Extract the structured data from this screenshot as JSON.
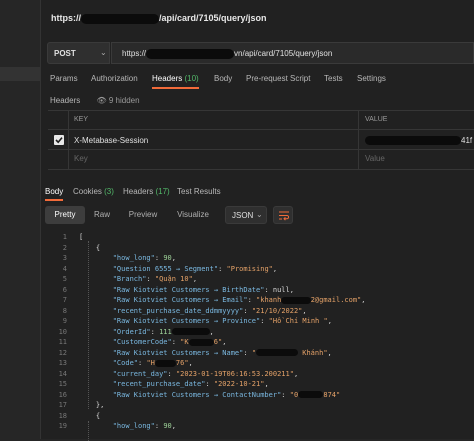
{
  "request": {
    "title_prefix": "https://",
    "title_suffix": "/api/card/7105/query/json",
    "method": "POST",
    "url_prefix": "https://",
    "url_suffix": "vn/api/card/7105/query/json"
  },
  "request_tabs": [
    {
      "label": "Params"
    },
    {
      "label": "Authorization"
    },
    {
      "label": "Headers",
      "count": "(10)"
    },
    {
      "label": "Body"
    },
    {
      "label": "Pre-request Script"
    },
    {
      "label": "Tests"
    },
    {
      "label": "Settings"
    }
  ],
  "headers_section": {
    "label": "Headers",
    "hidden": "9 hidden",
    "hidden_icon": "eye-off-icon"
  },
  "headers_table": {
    "col_key": "KEY",
    "col_value": "VALUE",
    "row_key": "X-Metabase-Session",
    "row_value_tail": "41f",
    "key_placeholder": "Key",
    "value_placeholder": "Value"
  },
  "response_tabs": [
    {
      "label": "Body"
    },
    {
      "label": "Cookies",
      "count": "(3)"
    },
    {
      "label": "Headers",
      "count": "(17)"
    },
    {
      "label": "Test Results"
    }
  ],
  "view_modes": [
    "Pretty",
    "Raw",
    "Preview",
    "Visualize"
  ],
  "format": "JSON",
  "wrap_icon": "wrap-lines-icon",
  "colors": {
    "accent": "#f26b3a",
    "count": "#53b96a",
    "json_key": "#7ab8e0",
    "json_string": "#e5a268",
    "json_number": "#9fd49a"
  },
  "code_lines": [
    {
      "n": "1",
      "parts": [
        {
          "t": "p",
          "v": "["
        }
      ]
    },
    {
      "n": "2",
      "parts": [
        {
          "t": "p",
          "v": "    {"
        }
      ]
    },
    {
      "n": "3",
      "parts": [
        {
          "t": "p",
          "v": "        "
        },
        {
          "t": "k",
          "v": "\"how_long\""
        },
        {
          "t": "p",
          "v": ": "
        },
        {
          "t": "n",
          "v": "90"
        },
        {
          "t": "p",
          "v": ","
        }
      ]
    },
    {
      "n": "4",
      "parts": [
        {
          "t": "p",
          "v": "        "
        },
        {
          "t": "k",
          "v": "\"Question 6555 → Segment\""
        },
        {
          "t": "p",
          "v": ": "
        },
        {
          "t": "s",
          "v": "\"Promising\""
        },
        {
          "t": "p",
          "v": ","
        }
      ]
    },
    {
      "n": "5",
      "parts": [
        {
          "t": "p",
          "v": "        "
        },
        {
          "t": "k",
          "v": "\"Branch\""
        },
        {
          "t": "p",
          "v": ": "
        },
        {
          "t": "s",
          "v": "\"Quận 10\""
        },
        {
          "t": "p",
          "v": ","
        }
      ]
    },
    {
      "n": "6",
      "parts": [
        {
          "t": "p",
          "v": "        "
        },
        {
          "t": "k",
          "v": "\"Raw Kiotviet Customers → BirthDate\""
        },
        {
          "t": "p",
          "v": ": null,"
        }
      ]
    },
    {
      "n": "7",
      "parts": [
        {
          "t": "p",
          "v": "        "
        },
        {
          "t": "k",
          "v": "\"Raw Kiotviet Customers → Email\""
        },
        {
          "t": "p",
          "v": ": "
        },
        {
          "t": "s",
          "v": "\"khanh"
        },
        {
          "t": "r",
          "v": "       "
        },
        {
          "t": "s",
          "v": "2@gmail.com\""
        },
        {
          "t": "p",
          "v": ","
        }
      ]
    },
    {
      "n": "8",
      "parts": [
        {
          "t": "p",
          "v": "        "
        },
        {
          "t": "k",
          "v": "\"recent_purchase_date_ddmmyyyy\""
        },
        {
          "t": "p",
          "v": ": "
        },
        {
          "t": "s",
          "v": "\"21/10/2022\""
        },
        {
          "t": "p",
          "v": ","
        }
      ]
    },
    {
      "n": "9",
      "parts": [
        {
          "t": "p",
          "v": "        "
        },
        {
          "t": "k",
          "v": "\"Raw Kiotviet Customers → Province\""
        },
        {
          "t": "p",
          "v": ": "
        },
        {
          "t": "s",
          "v": "\"Hồ Chí Minh \""
        },
        {
          "t": "p",
          "v": ","
        }
      ]
    },
    {
      "n": "10",
      "parts": [
        {
          "t": "p",
          "v": "        "
        },
        {
          "t": "k",
          "v": "\"OrderId\""
        },
        {
          "t": "p",
          "v": ": "
        },
        {
          "t": "n",
          "v": "111"
        },
        {
          "t": "r",
          "v": "         "
        },
        {
          "t": "p",
          "v": ","
        }
      ]
    },
    {
      "n": "11",
      "parts": [
        {
          "t": "p",
          "v": "        "
        },
        {
          "t": "k",
          "v": "\"CustomerCode\""
        },
        {
          "t": "p",
          "v": ": "
        },
        {
          "t": "s",
          "v": "\"K"
        },
        {
          "t": "r",
          "v": "      "
        },
        {
          "t": "s",
          "v": "6\""
        },
        {
          "t": "p",
          "v": ","
        }
      ]
    },
    {
      "n": "12",
      "parts": [
        {
          "t": "p",
          "v": "        "
        },
        {
          "t": "k",
          "v": "\"Raw Kiotviet Customers → Name\""
        },
        {
          "t": "p",
          "v": ": "
        },
        {
          "t": "s",
          "v": "\""
        },
        {
          "t": "r",
          "v": "          "
        },
        {
          "t": "s",
          "v": " Khánh\""
        },
        {
          "t": "p",
          "v": ","
        }
      ]
    },
    {
      "n": "13",
      "parts": [
        {
          "t": "p",
          "v": "        "
        },
        {
          "t": "k",
          "v": "\"Code\""
        },
        {
          "t": "p",
          "v": ": "
        },
        {
          "t": "s",
          "v": "\"H"
        },
        {
          "t": "r",
          "v": "     "
        },
        {
          "t": "s",
          "v": "76\""
        },
        {
          "t": "p",
          "v": ","
        }
      ]
    },
    {
      "n": "14",
      "parts": [
        {
          "t": "p",
          "v": "        "
        },
        {
          "t": "k",
          "v": "\"current_day\""
        },
        {
          "t": "p",
          "v": ": "
        },
        {
          "t": "s",
          "v": "\"2023-01-19T06:16:53.200211\""
        },
        {
          "t": "p",
          "v": ","
        }
      ]
    },
    {
      "n": "15",
      "parts": [
        {
          "t": "p",
          "v": "        "
        },
        {
          "t": "k",
          "v": "\"recent_purchase_date\""
        },
        {
          "t": "p",
          "v": ": "
        },
        {
          "t": "s",
          "v": "\"2022-10-21\""
        },
        {
          "t": "p",
          "v": ","
        }
      ]
    },
    {
      "n": "16",
      "parts": [
        {
          "t": "p",
          "v": "        "
        },
        {
          "t": "k",
          "v": "\"Raw Kiotviet Customers → ContactNumber\""
        },
        {
          "t": "p",
          "v": ": "
        },
        {
          "t": "s",
          "v": "\"0"
        },
        {
          "t": "r",
          "v": "      "
        },
        {
          "t": "s",
          "v": "874\""
        }
      ]
    },
    {
      "n": "17",
      "parts": [
        {
          "t": "p",
          "v": "    },"
        }
      ]
    },
    {
      "n": "18",
      "parts": [
        {
          "t": "p",
          "v": "    {"
        }
      ]
    },
    {
      "n": "19",
      "parts": [
        {
          "t": "p",
          "v": "        "
        },
        {
          "t": "k",
          "v": "\"how_long\""
        },
        {
          "t": "p",
          "v": ": "
        },
        {
          "t": "n",
          "v": "90"
        },
        {
          "t": "p",
          "v": ","
        }
      ]
    }
  ]
}
